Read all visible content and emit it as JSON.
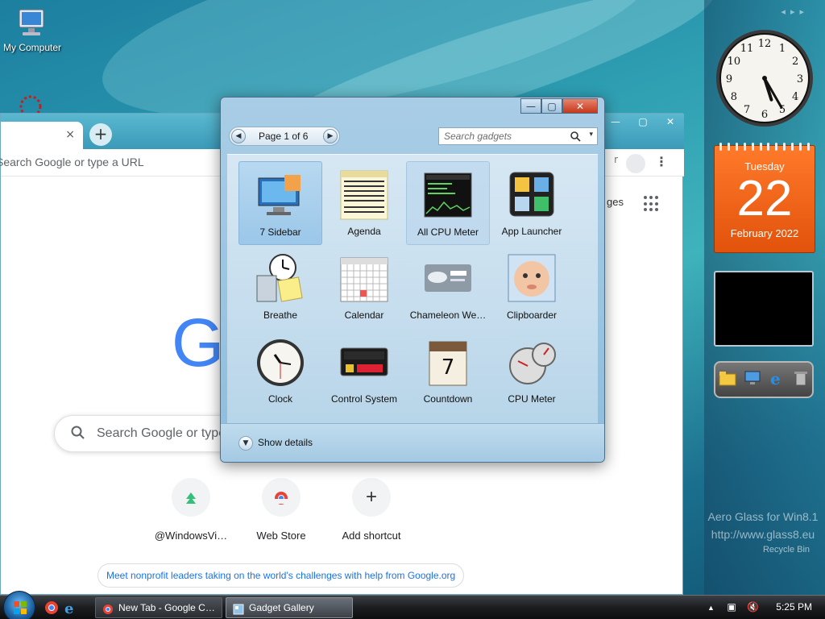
{
  "desktop": {
    "icons": [
      {
        "label": "My Computer"
      }
    ],
    "watermark_line1": "Aero Glass for Win8.1",
    "watermark_line2": "http://www.glass8.eu",
    "recycle_bin": "Recycle Bin"
  },
  "sidebar": {
    "calendar": {
      "day_name": "Tuesday",
      "day_number": "22",
      "month_year": "February 2022"
    },
    "clock": {
      "hour": 5,
      "minute": 25
    }
  },
  "browser": {
    "tab_close": "×",
    "new_tab": "+",
    "window_buttons": [
      "—",
      "▢",
      "✕"
    ],
    "address_placeholder": "Search Google or type a URL",
    "images_link": "ges",
    "google_logo": "Go",
    "search_placeholder": "Search Google or type",
    "shortcuts": [
      {
        "label": "@WindowsVi…",
        "icon": "windowsvista-icon"
      },
      {
        "label": "Web Store",
        "icon": "chrome-webstore-icon"
      },
      {
        "label": "Add shortcut",
        "icon": "plus-icon",
        "glyph": "+"
      }
    ],
    "promo": "Meet nonprofit leaders taking on the world's challenges with help from Google.org"
  },
  "gallery": {
    "title_buttons": [
      "—",
      "▢",
      "✕"
    ],
    "pager": {
      "prev": "◀",
      "next": "▶",
      "text": "Page 1 of 6"
    },
    "search_placeholder": "Search gadgets",
    "dropdown_glyph": "▾",
    "items": [
      {
        "label": "7 Sidebar",
        "icon": "monitor-icon"
      },
      {
        "label": "Agenda",
        "icon": "agenda-icon"
      },
      {
        "label": "All CPU Meter",
        "icon": "cpu-graph-icon"
      },
      {
        "label": "App Launcher",
        "icon": "app-launcher-icon"
      },
      {
        "label": "Breathe",
        "icon": "calculator-clock-icon"
      },
      {
        "label": "Calendar",
        "icon": "calendar-icon"
      },
      {
        "label": "Chameleon We…",
        "icon": "weather-icon"
      },
      {
        "label": "Clipboarder",
        "icon": "baby-photo-icon"
      },
      {
        "label": "Clock",
        "icon": "clock-icon"
      },
      {
        "label": "Control System",
        "icon": "control-system-icon"
      },
      {
        "label": "Countdown",
        "icon": "countdown-icon"
      },
      {
        "label": "CPU Meter",
        "icon": "gauge-icon"
      }
    ],
    "show_details": "Show details",
    "details_chevron": "▼"
  },
  "taskbar": {
    "buttons": [
      {
        "label": "New Tab - Google C…",
        "icon": "chrome-icon"
      },
      {
        "label": "Gadget Gallery",
        "icon": "gadget-icon"
      }
    ],
    "time": "5:25 PM",
    "tray_arrow": "▲"
  }
}
